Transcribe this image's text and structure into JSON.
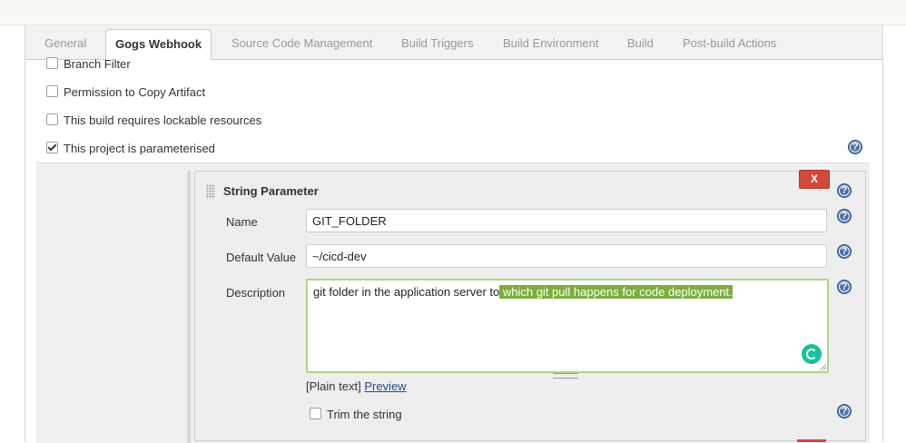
{
  "tabs": [
    {
      "label": "General",
      "active": false
    },
    {
      "label": "Gogs Webhook",
      "active": true
    },
    {
      "label": "Source Code Management",
      "active": false
    },
    {
      "label": "Build Triggers",
      "active": false
    },
    {
      "label": "Build Environment",
      "active": false
    },
    {
      "label": "Build",
      "active": false
    },
    {
      "label": "Post-build Actions",
      "active": false
    }
  ],
  "options": [
    {
      "label": "Branch Filter",
      "checked": false
    },
    {
      "label": "Permission to Copy Artifact",
      "checked": false
    },
    {
      "label": "This build requires lockable resources",
      "checked": false
    },
    {
      "label": "This project is parameterised",
      "checked": true
    }
  ],
  "help_glyph": "?",
  "parameter": {
    "title": "String Parameter",
    "delete_label": "X",
    "name_label": "Name",
    "name_value": "GIT_FOLDER",
    "default_label": "Default Value",
    "default_value": "~/cicd-dev",
    "description_label": "Description",
    "description_plain": "git folder in the application server to",
    "description_highlight": " which git pull happens for code deployment.",
    "format_note": "[Plain text]",
    "preview_link": "Preview",
    "trim_label": "Trim the string",
    "trim_checked": false
  },
  "colors": {
    "delete_button": "#d24939",
    "help_icon": "#4a6fa5",
    "highlight": "#7cae3c",
    "grammarly": "#15c39a"
  }
}
